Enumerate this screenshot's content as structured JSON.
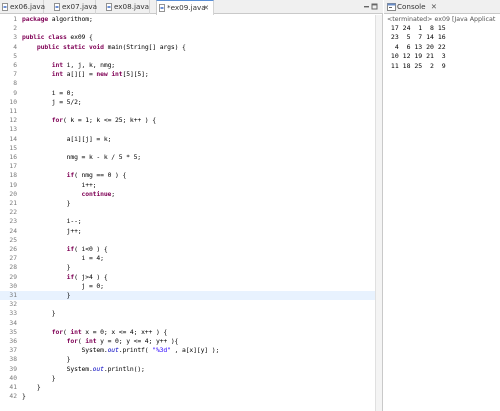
{
  "editor": {
    "tabs": [
      {
        "label": "ex06.java",
        "active": false
      },
      {
        "label": "ex07.java",
        "active": false
      },
      {
        "label": "ex08.java",
        "active": false
      },
      {
        "label": "*ex09.java",
        "active": true
      }
    ],
    "close_glyph": "✕",
    "highlighted_line": 31,
    "lines": [
      "package algorithom;",
      "",
      "public class ex09 {",
      "    public static void main(String[] args) {",
      "",
      "        int i, j, k, nmg;",
      "        int a[][] = new int[5][5];",
      "",
      "        i = 0;",
      "        j = 5/2;",
      "",
      "        for( k = 1; k <= 25; k++ ) {",
      "",
      "            a[i][j] = k;",
      "",
      "            nmg = k - k / 5 * 5;",
      "",
      "            if( nmg == 0 ) {",
      "                i++;",
      "                continue;",
      "            }",
      "",
      "            i--;",
      "            j++;",
      "",
      "            if( i<0 ) {",
      "                i = 4;",
      "            }",
      "            if( j>4 ) {",
      "                j = 0;",
      "            }",
      "",
      "        }",
      "",
      "        for( int x = 0; x <= 4; x++ ) {",
      "            for( int y = 0; y <= 4; y++ ){",
      "                System.out.printf( \"%3d\" , a[x][y] );",
      "            }",
      "            System.out.println();",
      "        }",
      "    }",
      "}"
    ]
  },
  "console": {
    "tab_label": "Console",
    "close_glyph": "✕",
    "status": "<terminated> ex09 [Java Applicat",
    "output": [
      " 17 24  1  8 15",
      " 23  5  7 14 16",
      "  4  6 13 20 22",
      " 10 12 19 21  3",
      " 11 18 25  2  9"
    ]
  }
}
